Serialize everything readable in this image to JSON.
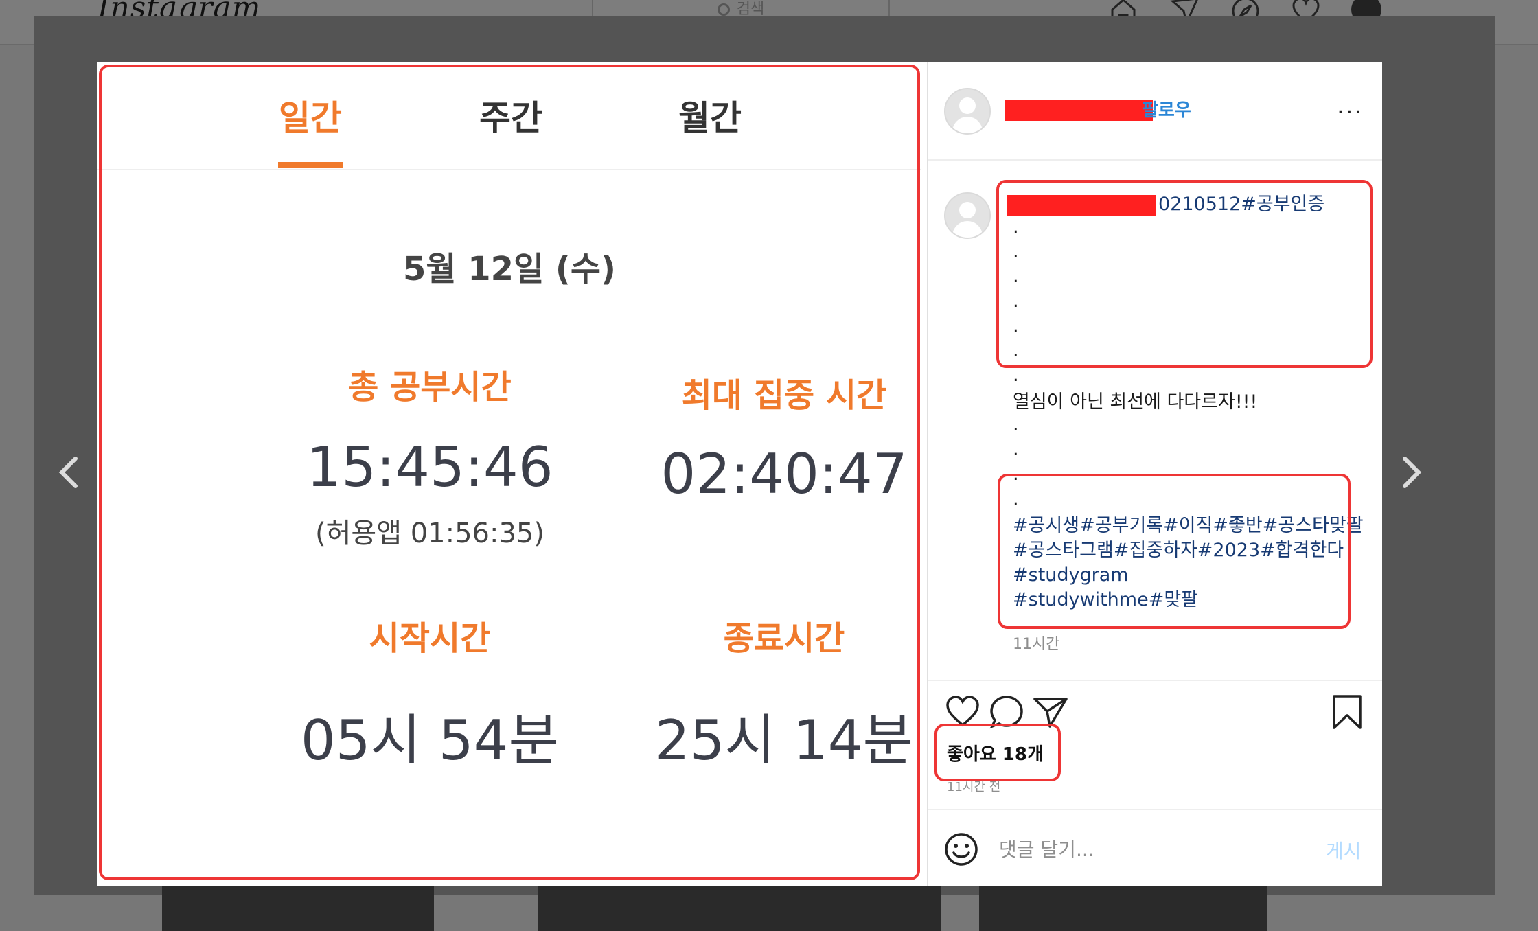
{
  "background": {
    "logo": "Instagram",
    "search_placeholder": "검색"
  },
  "study_app": {
    "tabs": [
      {
        "label": "일간",
        "active": true
      },
      {
        "label": "주간",
        "active": false
      },
      {
        "label": "월간",
        "active": false
      }
    ],
    "date": "5월 12일 (수)",
    "total_study": {
      "label": "총 공부시간",
      "value": "15:45:46",
      "sub": "(허용앱  01:56:35)"
    },
    "max_focus": {
      "label": "최대 집중 시간",
      "value": "02:40:47"
    },
    "start_time": {
      "label": "시작시간",
      "value": "05시 54분"
    },
    "end_time": {
      "label": "종료시간",
      "value": "25시 14분"
    },
    "accent_color": "#f07a2c"
  },
  "post": {
    "follow_label": "팔로우",
    "more_label": "...",
    "caption_tag_line": "0210512#공부인증",
    "caption_dots_top": [
      ".",
      ".",
      ".",
      ".",
      ".",
      ".",
      "."
    ],
    "caption_text": "열심이 아닌 최선에 다다르자!!!",
    "caption_dots_bottom": [
      ".",
      ".",
      ".",
      "."
    ],
    "hashtags": [
      "#공시생#공부기록#이직#좋반#공스타맞팔",
      "#공스타그램#집중하자#2023#합격한다",
      "#studygram",
      "#studywithme#맞팔"
    ],
    "caption_time": "11시간",
    "likes": "좋아요 18개",
    "posted_ago": "11시간 전",
    "comment_placeholder": "댓글 달기...",
    "post_button": "게시"
  }
}
